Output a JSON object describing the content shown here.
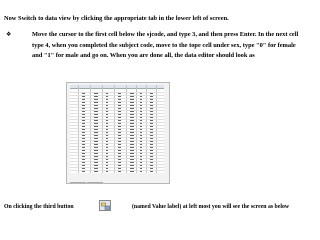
{
  "heading": "Now Switch to data view by clicking the appropriate tab in the lower left of screen.",
  "bullet": {
    "icon": "diamond-bullet-icon",
    "text": "Move the cursor to the first cell below the sjcode, and type 3, and then press Enter. In the next cell type 4, when you completed the subject code, move to the tope cell under sex, type \"0\" for female and \"1\" for male and go on. When you are done all, the data editor should look as"
  },
  "screenshot": {
    "icon": "data-editor-screenshot-image"
  },
  "footer": {
    "before": "On clicking the third button",
    "button_icon": "value-labels-button-icon",
    "after": "(named Value label) at left most you will see the screen as below"
  }
}
